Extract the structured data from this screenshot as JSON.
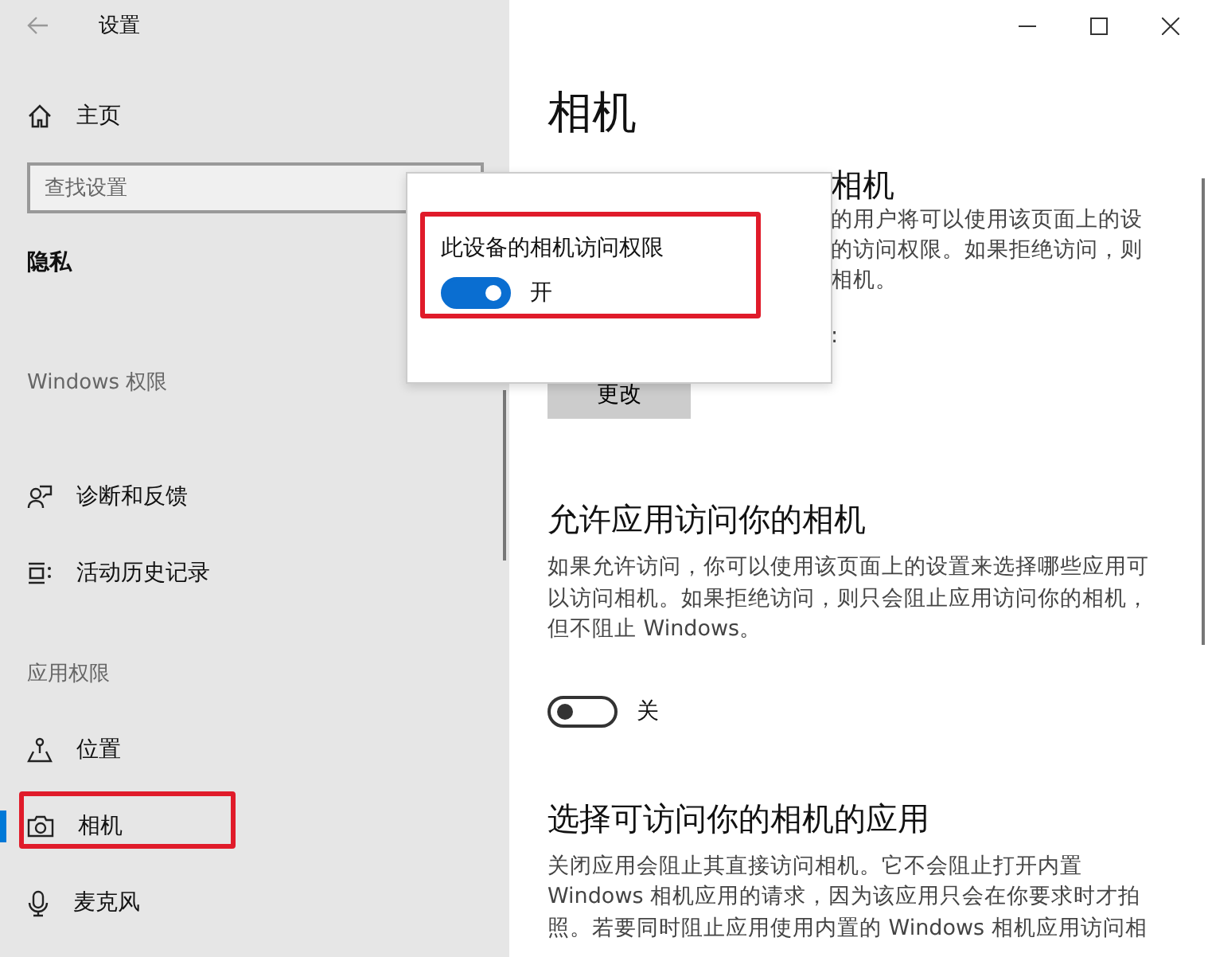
{
  "window": {
    "title": "设置"
  },
  "sidebar": {
    "home": "主页",
    "search": {
      "placeholder": "查找设置"
    },
    "section": "隐私",
    "groups": [
      {
        "heading": "Windows 权限",
        "items": [
          {
            "label": "诊断和反馈",
            "selected": false
          },
          {
            "label": "活动历史记录",
            "selected": false
          }
        ]
      },
      {
        "heading": "应用权限",
        "items": [
          {
            "label": "位置",
            "selected": false
          },
          {
            "label": "相机",
            "selected": true
          },
          {
            "label": "麦克风",
            "selected": false
          }
        ]
      }
    ]
  },
  "page": {
    "title": "相机",
    "partial_section": {
      "heading": "相机",
      "lines": [
        "的用户将可以使用该页面上的设",
        "的访问权限。如果拒绝访问，则",
        "相机。"
      ],
      "trailing": ":"
    },
    "change_button": "更改",
    "sections": [
      {
        "heading": "允许应用访问你的相机",
        "description": "如果允许访问，你可以使用该页面上的设置来选择哪些应用可以访问相机。如果拒绝访问，则只会阻止应用访问你的相机，但不阻止 Windows。",
        "toggle": {
          "on": false,
          "label": "关"
        }
      },
      {
        "heading": "选择可访问你的相机的应用",
        "description": "关闭应用会阻止其直接访问相机。它不会阻止打开内置 Windows 相机应用的请求，因为该应用只会在你要求时才拍照。若要同时阻止应用使用内置的 Windows 相机应用访问相"
      }
    ]
  },
  "popup": {
    "title": "此设备的相机访问权限",
    "toggle": {
      "on": true,
      "label": "开"
    }
  }
}
